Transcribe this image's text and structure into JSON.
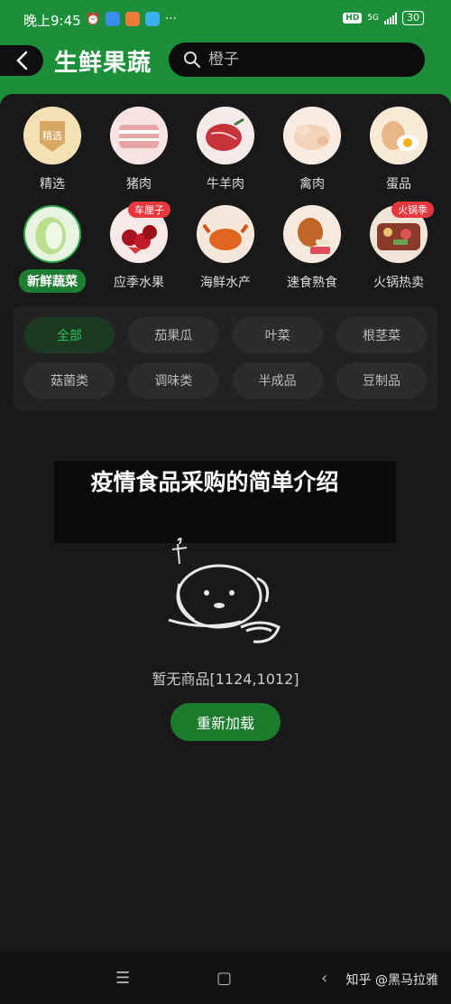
{
  "status": {
    "time": "晚上9:45",
    "network": "5G",
    "hd": "HD",
    "battery": "30"
  },
  "header": {
    "title": "生鲜果蔬",
    "search_placeholder": "橙子"
  },
  "categories_row1": [
    {
      "label": "精选",
      "icon": "selected-badge-icon"
    },
    {
      "label": "猪肉",
      "icon": "pork-image"
    },
    {
      "label": "牛羊肉",
      "icon": "beef-image"
    },
    {
      "label": "禽肉",
      "icon": "poultry-image"
    },
    {
      "label": "蛋品",
      "icon": "egg-image"
    }
  ],
  "categories_row2": [
    {
      "label": "新鲜蔬菜",
      "icon": "cabbage-image",
      "active": true
    },
    {
      "label": "应季水果",
      "icon": "cherry-image",
      "badge": "车厘子"
    },
    {
      "label": "海鲜水产",
      "icon": "crab-image"
    },
    {
      "label": "速食熟食",
      "icon": "chicken-leg-image"
    },
    {
      "label": "火锅热卖",
      "icon": "hotpot-image",
      "badge": "火锅季"
    }
  ],
  "selected_badge_text": "精选",
  "tags": [
    [
      "全部",
      "茄果瓜",
      "叶菜",
      "根茎菜"
    ],
    [
      "菇菌类",
      "调味类",
      "半成品",
      "豆制品"
    ]
  ],
  "banner": {
    "text": "疫情食品采购的简单介绍"
  },
  "empty": {
    "message": "暂无商品[1124,1012]",
    "reload_label": "重新加载"
  },
  "watermark": "知乎 @黑马拉雅",
  "colors": {
    "brand_green": "#1c8f3a",
    "active_tag_text": "#2fbf53",
    "badge_red": "#e8373c"
  }
}
